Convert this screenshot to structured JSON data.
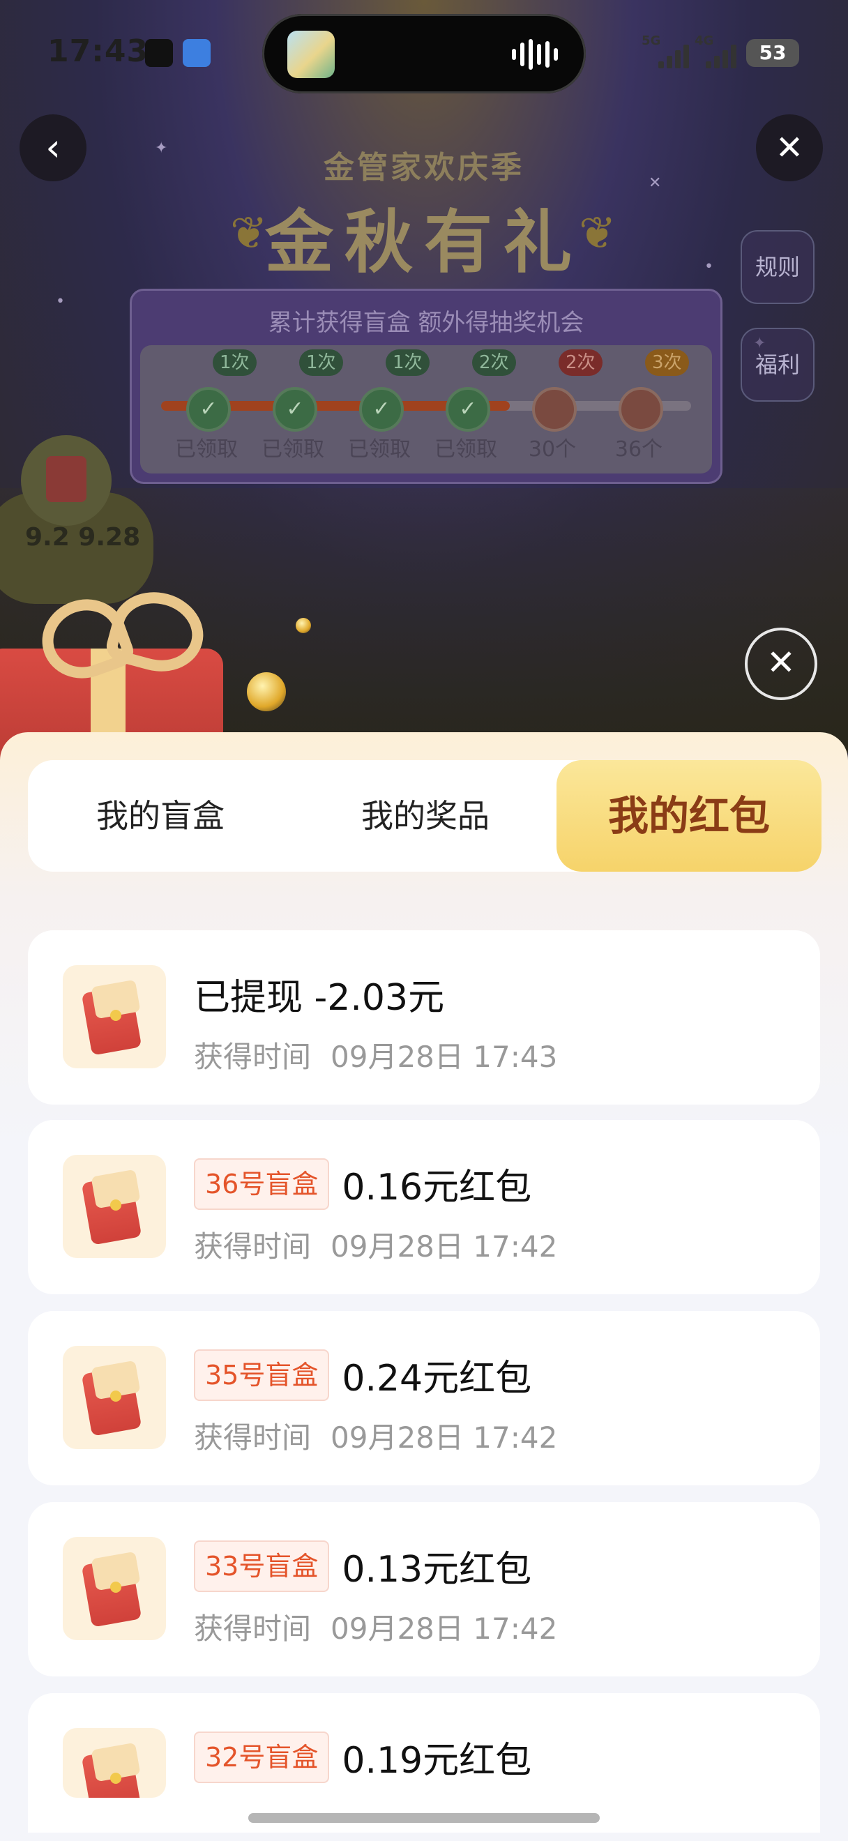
{
  "status_bar": {
    "time": "17:43",
    "signal_1": "5G",
    "signal_2": "4G",
    "battery": "53"
  },
  "header": {
    "subtitle": "金管家欢庆季",
    "title": "金秋有礼",
    "rules_label": "规则",
    "welfare_label": "福利"
  },
  "progress_panel": {
    "title": "累计获得盲盒 额外得抽奖机会",
    "nodes": [
      {
        "badge": "1次",
        "label": "已领取"
      },
      {
        "badge": "1次",
        "label": "已领取"
      },
      {
        "badge": "1次",
        "label": "已领取"
      },
      {
        "badge": "2次",
        "label": "已领取"
      },
      {
        "badge": "2次",
        "label": "30个"
      },
      {
        "badge": "3次",
        "label": "36个"
      }
    ],
    "progress_fraction": 0.66
  },
  "float_widget": {
    "date_text": "9.2 9.28"
  },
  "tabs": [
    {
      "label": "我的盲盒"
    },
    {
      "label": "我的奖品"
    },
    {
      "label": "我的红包"
    }
  ],
  "active_tab": "我的红包",
  "time_label": "获得时间",
  "records": [
    {
      "tag": "",
      "title": "已提现 -2.03元",
      "time": "09月28日 17:43"
    },
    {
      "tag": "36号盲盒",
      "title": "0.16元红包",
      "time": "09月28日 17:42"
    },
    {
      "tag": "35号盲盒",
      "title": "0.24元红包",
      "time": "09月28日 17:42"
    },
    {
      "tag": "33号盲盒",
      "title": "0.13元红包",
      "time": "09月28日 17:42"
    },
    {
      "tag": "32号盲盒",
      "title": "0.19元红包",
      "time": ""
    }
  ],
  "colors": {
    "accent_tab": "#f6d36a",
    "tag_text": "#e4542a",
    "tag_bg": "#fff1ec"
  }
}
